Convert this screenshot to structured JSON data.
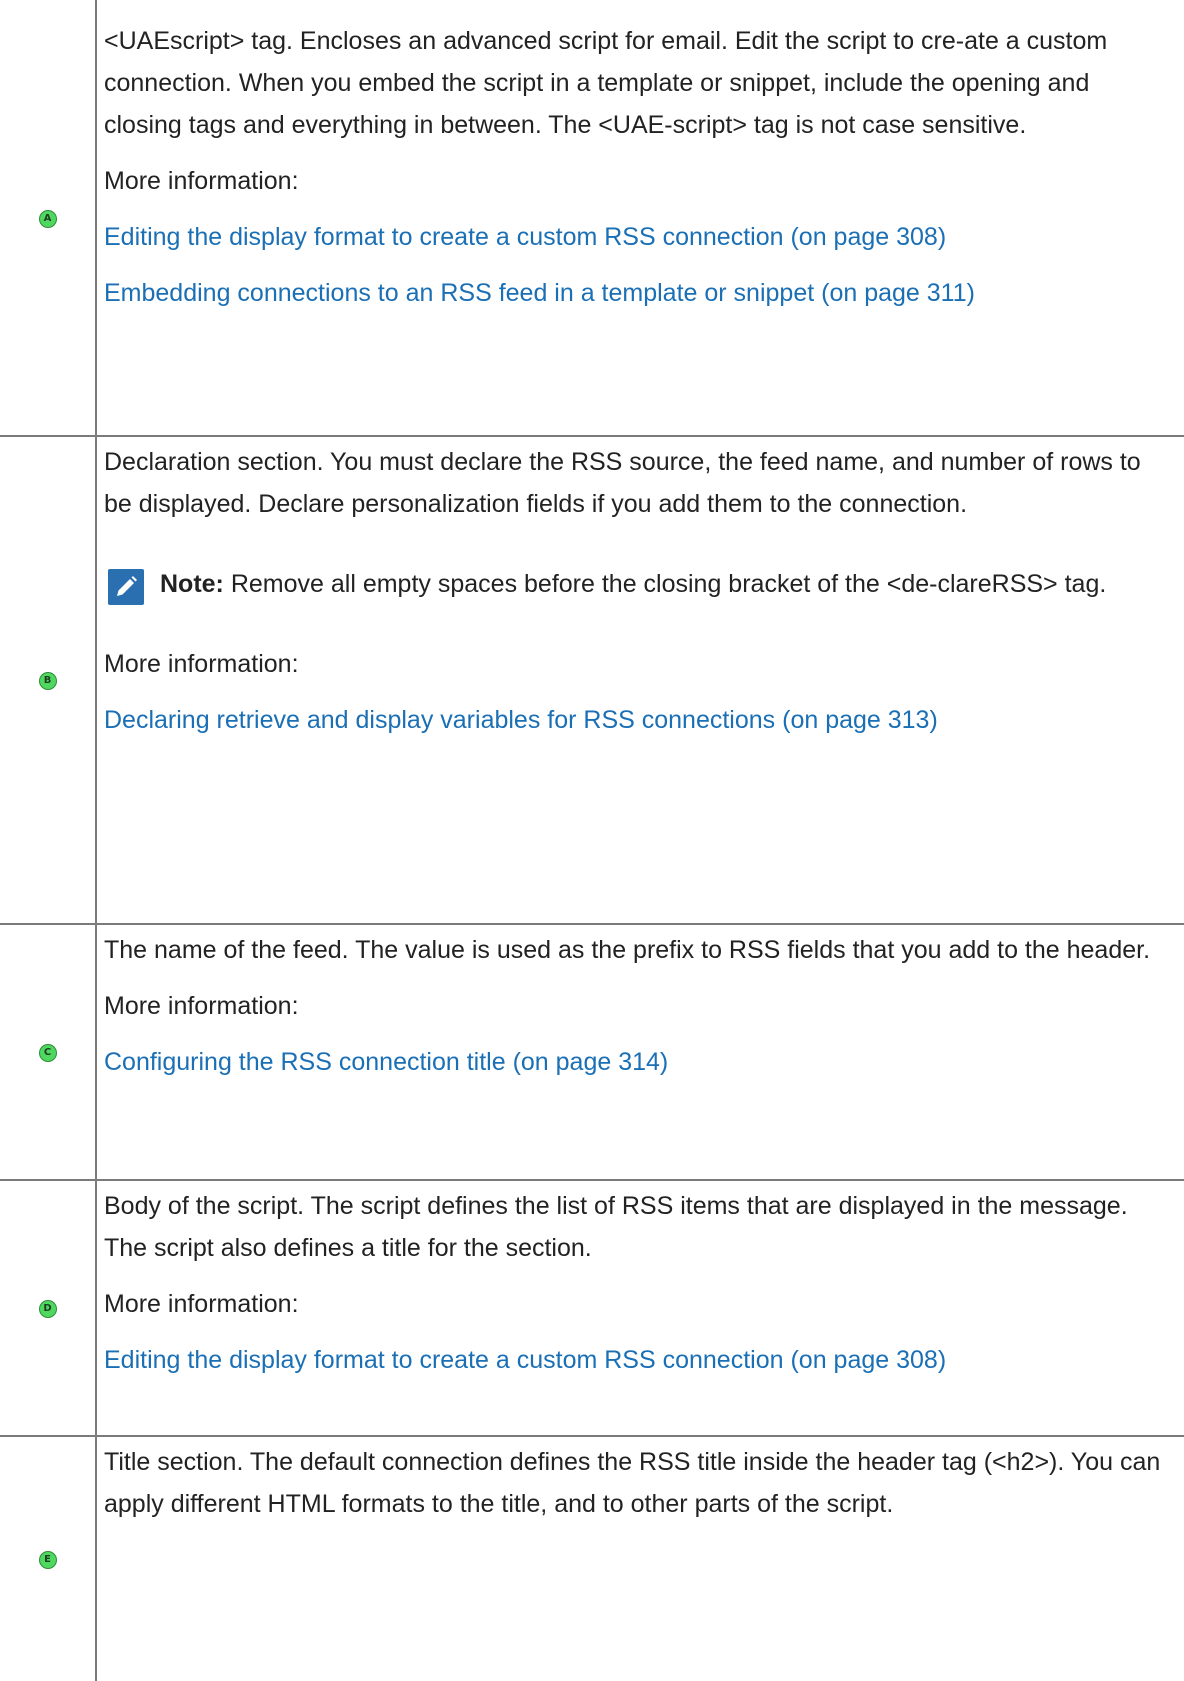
{
  "rows": [
    {
      "badge": "A",
      "description": "<UAEscript> tag. Encloses an advanced script for email. Edit the script to cre-ate a custom connection. When you embed the script in a template or snippet, include the opening and closing tags and everything in between. The <UAE-script> tag is not case sensitive.",
      "more_info_label": "More information:",
      "links": [
        "Editing the display format to create a custom RSS connection (on page 308)",
        "Embedding connections to an RSS feed in a template or snippet (on page 311)"
      ]
    },
    {
      "badge": "B",
      "description": "Declaration section. You must declare the RSS source, the feed name, and number of rows to be displayed. Declare personalization fields if you add them to the connection.",
      "note_label": "Note:",
      "note_text": " Remove all empty spaces before the closing bracket of the <de-clareRSS> tag.",
      "more_info_label": "More information:",
      "links": [
        "Declaring retrieve and display variables for RSS connections (on page 313)"
      ]
    },
    {
      "badge": "C",
      "description": "The name of the feed. The value is used as the prefix to RSS fields that you add to the header.",
      "more_info_label": "More information:",
      "links": [
        "Configuring the RSS connection title (on page 314)"
      ]
    },
    {
      "badge": "D",
      "description": "Body of the script. The script defines the list of RSS items that are displayed in the message. The script also defines a title for the section.",
      "more_info_label": "More information:",
      "links": [
        "Editing the display format to create a custom RSS connection (on page 308)"
      ]
    },
    {
      "badge": "E",
      "description": "Title section. The default connection defines the RSS title inside the header tag (<h2>). You can apply different HTML formats to the title, and to other parts of the script."
    }
  ],
  "colors": {
    "link": "#1a6fb5",
    "badge": "#4ed85f",
    "note_icon": "#2a6fb0",
    "border": "#7b7b7b"
  },
  "icons": {
    "badge": "circled-letter-icon",
    "note": "pencil-note-icon"
  }
}
